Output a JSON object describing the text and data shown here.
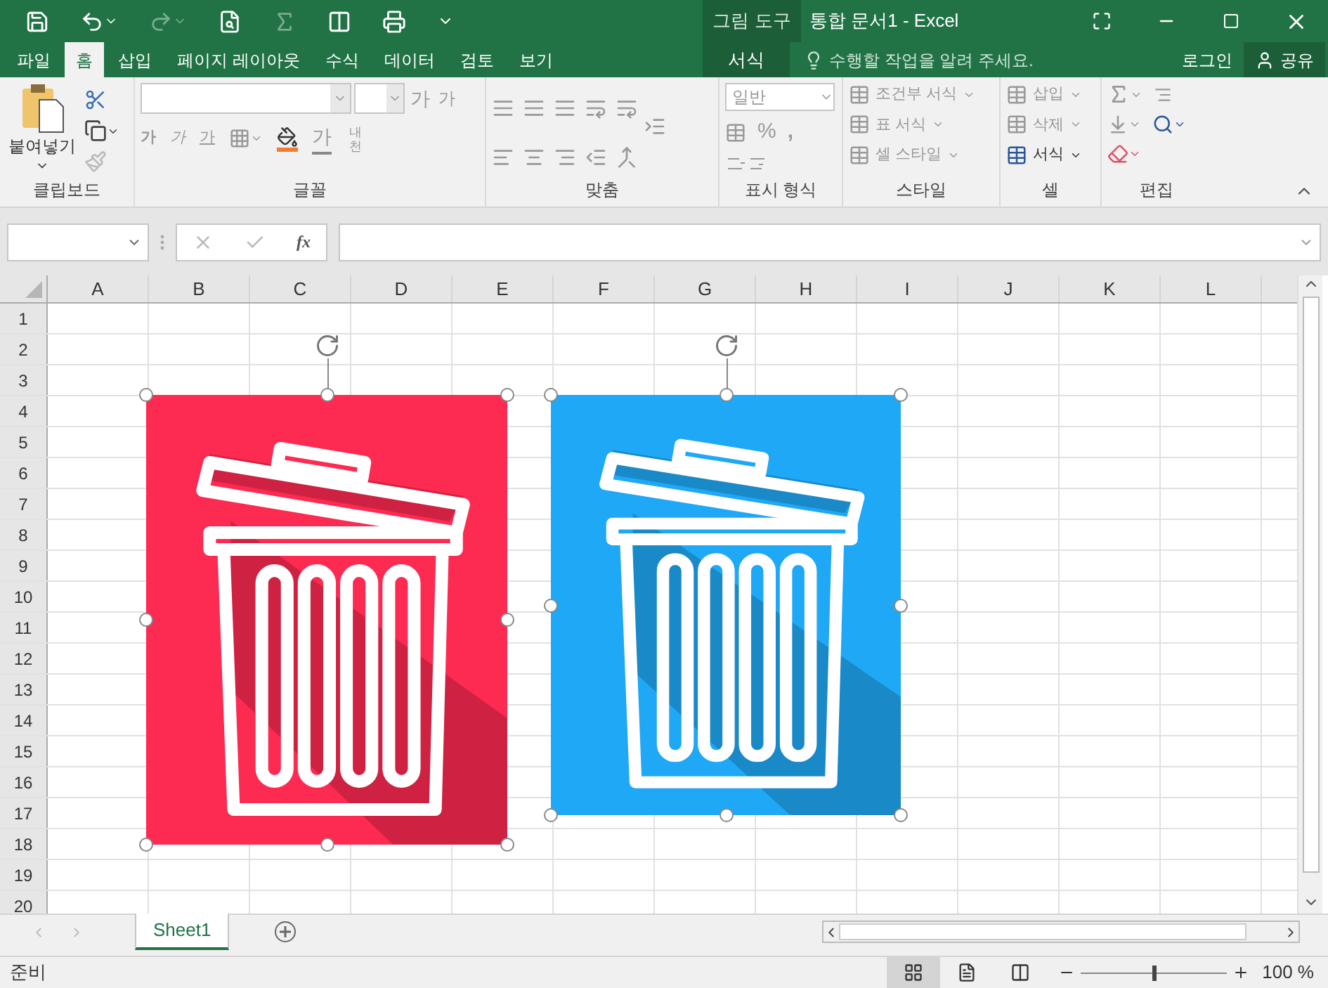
{
  "title_bar": {
    "context_label": "그림 도구",
    "title": "통합 문서1 - Excel"
  },
  "tabs": [
    {
      "label": "파일",
      "selected": false
    },
    {
      "label": "홈",
      "selected": true
    },
    {
      "label": "삽입",
      "selected": false
    },
    {
      "label": "페이지 레이아웃",
      "selected": false
    },
    {
      "label": "수식",
      "selected": false
    },
    {
      "label": "데이터",
      "selected": false
    },
    {
      "label": "검토",
      "selected": false
    },
    {
      "label": "보기",
      "selected": false
    }
  ],
  "context_tab": {
    "label": "서식",
    "selected": false
  },
  "tell_me": {
    "placeholder": "수행할 작업을 알려 주세요."
  },
  "account": {
    "sign_in": "로그인",
    "share": "공유"
  },
  "ribbon": {
    "clipboard": {
      "paste": "붙여넣기",
      "label": "클립보드"
    },
    "font": {
      "bold": "가",
      "italic": "가",
      "underline": "가",
      "grow": "가",
      "shrink": "가",
      "font_color": "가",
      "phonetic": "내천",
      "label": "글꼴"
    },
    "alignment": {
      "label": "맞춤"
    },
    "number": {
      "format": "일반",
      "percent": "%",
      "comma": ",",
      "label": "표시 형식"
    },
    "styles": {
      "items": [
        "조건부 서식",
        "표 서식",
        "셀 스타일"
      ],
      "label": "스타일"
    },
    "cells": {
      "items": [
        "삽입",
        "삭제",
        "서식"
      ],
      "label": "셀"
    },
    "editing": {
      "label": "편집"
    }
  },
  "formula_bar": {
    "fx": "fx"
  },
  "columns": [
    "A",
    "B",
    "C",
    "D",
    "E",
    "F",
    "G",
    "H",
    "I",
    "J",
    "K",
    "L"
  ],
  "rows": [
    "1",
    "2",
    "3",
    "4",
    "5",
    "6",
    "7",
    "8",
    "9",
    "10",
    "11",
    "12",
    "13",
    "14",
    "15",
    "16",
    "17",
    "18",
    "19",
    "20"
  ],
  "pictures": [
    {
      "color": "#fd2a51"
    },
    {
      "color": "#1fa8f5"
    }
  ],
  "sheets": [
    {
      "label": "Sheet1",
      "selected": true
    }
  ],
  "status_bar": {
    "status": "준비",
    "zoom": {
      "level": 0.5,
      "reading": "100 %"
    }
  }
}
